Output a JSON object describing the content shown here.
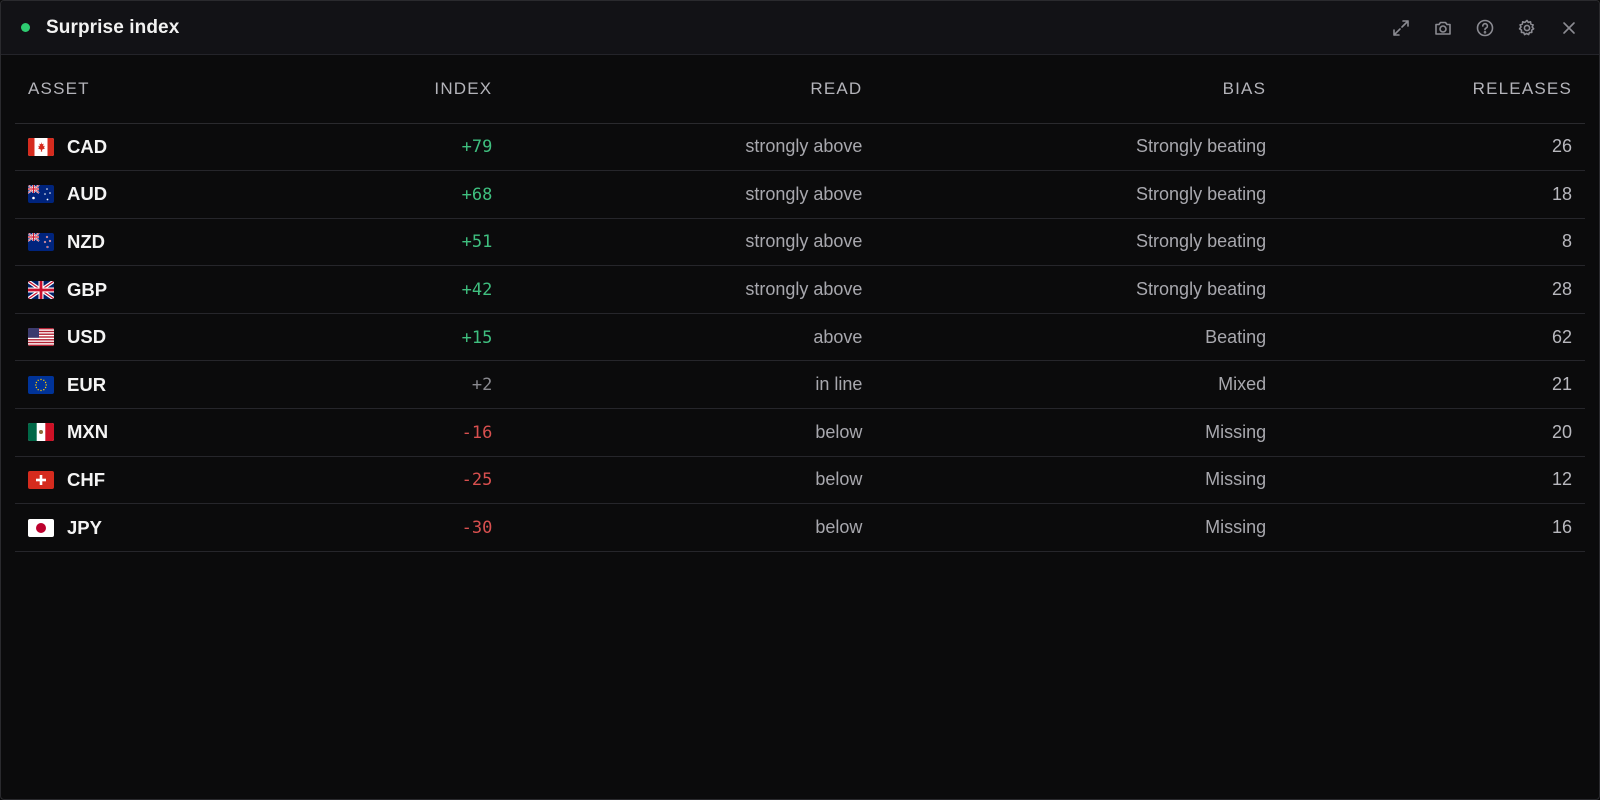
{
  "window": {
    "title": "Surprise index",
    "status_color": "#2ecc71",
    "actions": [
      "expand-icon",
      "camera-icon",
      "help-icon",
      "gear-icon",
      "close-icon"
    ]
  },
  "table": {
    "headers": {
      "asset": "ASSET",
      "index": "INDEX",
      "read": "READ",
      "bias": "BIAS",
      "releases": "RELEASES"
    },
    "rows": [
      {
        "code": "CAD",
        "flag": "ca-flag-icon",
        "index": "+79",
        "tone": "pos",
        "read": "strongly above",
        "bias": "Strongly beating",
        "releases": "26"
      },
      {
        "code": "AUD",
        "flag": "au-flag-icon",
        "index": "+68",
        "tone": "pos",
        "read": "strongly above",
        "bias": "Strongly beating",
        "releases": "18"
      },
      {
        "code": "NZD",
        "flag": "nz-flag-icon",
        "index": "+51",
        "tone": "pos",
        "read": "strongly above",
        "bias": "Strongly beating",
        "releases": "8"
      },
      {
        "code": "GBP",
        "flag": "gb-flag-icon",
        "index": "+42",
        "tone": "pos",
        "read": "strongly above",
        "bias": "Strongly beating",
        "releases": "28"
      },
      {
        "code": "USD",
        "flag": "us-flag-icon",
        "index": "+15",
        "tone": "pos",
        "read": "above",
        "bias": "Beating",
        "releases": "62"
      },
      {
        "code": "EUR",
        "flag": "eu-flag-icon",
        "index": "+2",
        "tone": "neutral",
        "read": "in line",
        "bias": "Mixed",
        "releases": "21"
      },
      {
        "code": "MXN",
        "flag": "mx-flag-icon",
        "index": "-16",
        "tone": "neg",
        "read": "below",
        "bias": "Missing",
        "releases": "20"
      },
      {
        "code": "CHF",
        "flag": "ch-flag-icon",
        "index": "-25",
        "tone": "neg",
        "read": "below",
        "bias": "Missing",
        "releases": "12"
      },
      {
        "code": "JPY",
        "flag": "jp-flag-icon",
        "index": "-30",
        "tone": "neg",
        "read": "below",
        "bias": "Missing",
        "releases": "16"
      }
    ]
  },
  "colors": {
    "positive": "#3fbf7f",
    "neutral": "#8a8a90",
    "negative": "#d9504f"
  }
}
